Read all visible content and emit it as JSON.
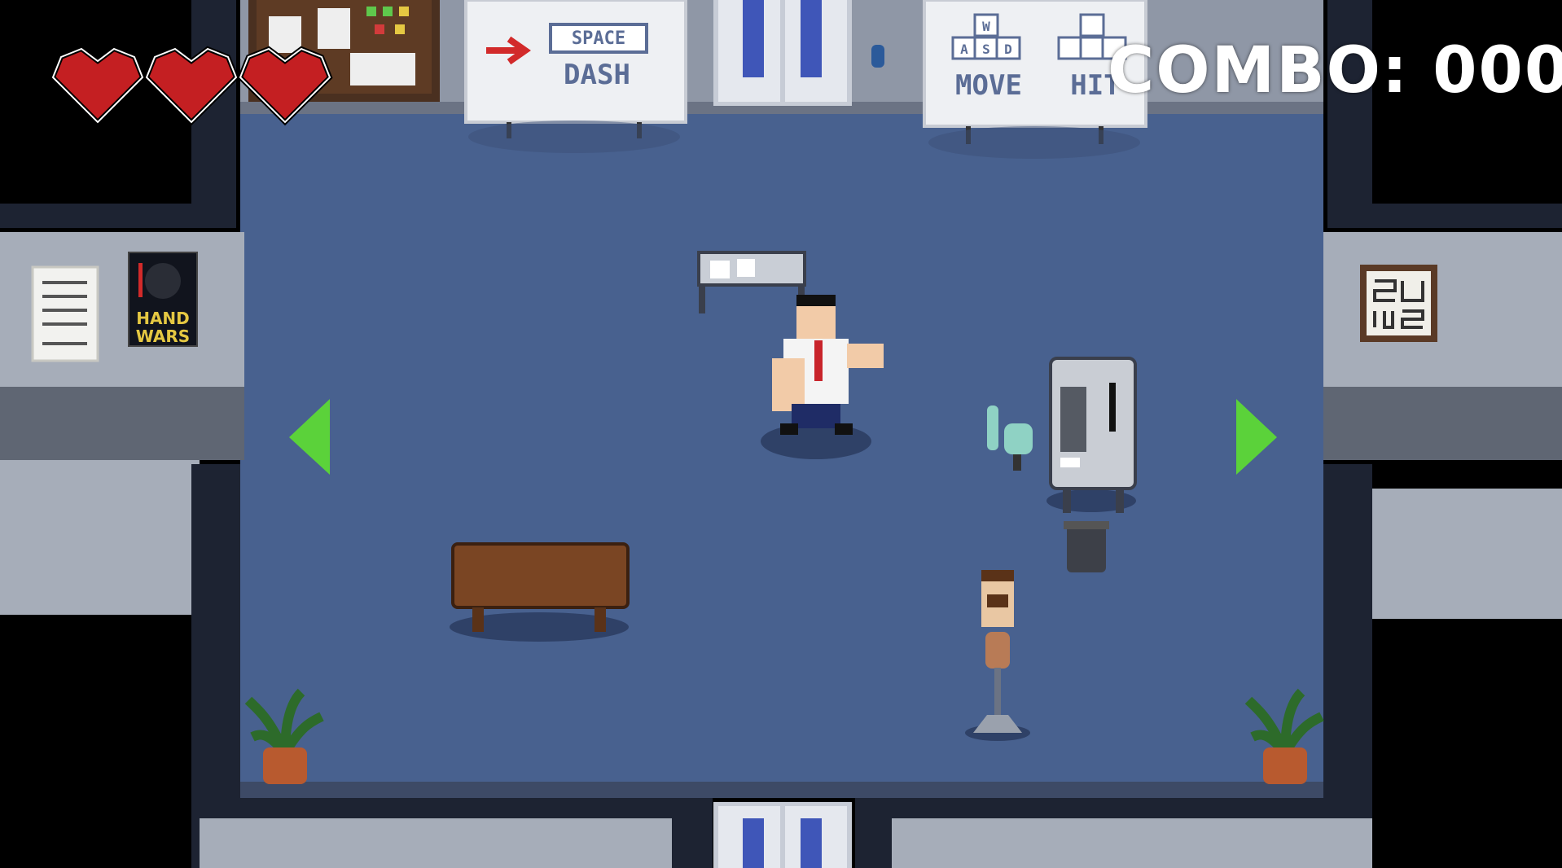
{
  "hud": {
    "hearts": 3,
    "hearts_max": 3,
    "combo_label": "COMBO:",
    "combo_value": "000"
  },
  "signs": {
    "dash": {
      "key": "SPACE",
      "action": "DASH"
    },
    "move": {
      "keys": [
        "W",
        "A",
        "S",
        "D"
      ],
      "action": "MOVE"
    },
    "hit": {
      "action": "HIT"
    }
  },
  "poster": {
    "line1": "HAND",
    "line2": "WARS"
  },
  "nav": {
    "left": "left-arrow",
    "right": "right-arrow"
  },
  "colors": {
    "floor": "#48618f",
    "wall": "#9aa1ad",
    "arrow": "#5bd23a",
    "heart": "#c41f22",
    "combo": "#ffffff"
  }
}
